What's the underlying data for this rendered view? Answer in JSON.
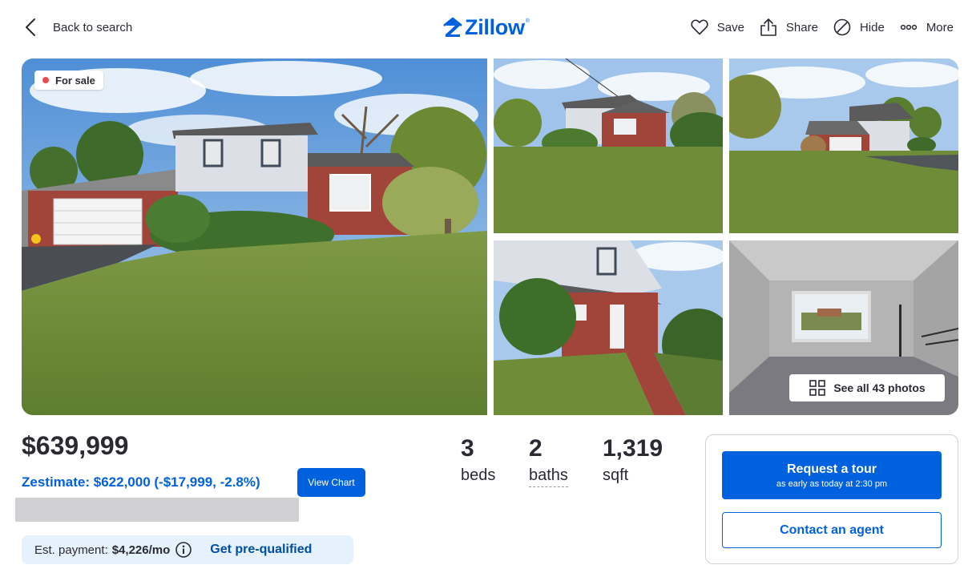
{
  "header": {
    "back_label": "Back to search",
    "brand": "Zillow",
    "brand_mark": "®",
    "actions": [
      {
        "label": "Save",
        "icon": "heart-icon"
      },
      {
        "label": "Share",
        "icon": "share-icon"
      },
      {
        "label": "Hide",
        "icon": "hide-icon"
      },
      {
        "label": "More",
        "icon": "more-icon"
      }
    ]
  },
  "gallery": {
    "status_badge": "For sale",
    "see_all_label": "See all 43 photos"
  },
  "summary": {
    "price": "$639,999",
    "zestimate": "Zestimate: $622,000 (-$17,999, -2.8%)",
    "view_chart_label": "View Chart",
    "est_payment_label": "Est. payment:",
    "est_payment_amount": "$4,226/mo",
    "prequal_label": "Get pre-qualified",
    "facts": [
      {
        "value": "3",
        "unit": "beds"
      },
      {
        "value": "2",
        "unit": "baths"
      },
      {
        "value": "1,319",
        "unit": "sqft"
      }
    ]
  },
  "cta": {
    "tour_label": "Request a tour",
    "tour_sub": "as early as today at 2:30 pm",
    "agent_label": "Contact an agent"
  },
  "colors": {
    "brand_blue": "#0061df",
    "text": "#2a2a33",
    "for_sale_dot": "#eb4d4d",
    "est_bg": "#e5f1fc"
  }
}
